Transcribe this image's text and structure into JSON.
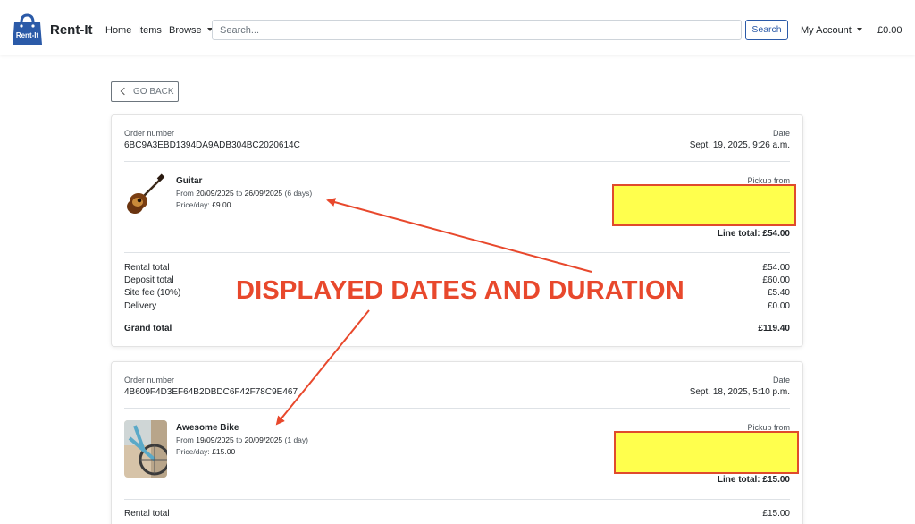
{
  "navbar": {
    "brand": "Rent-It",
    "logo_text": "Rent-It",
    "links": [
      "Home",
      "Items"
    ],
    "browse_label": "Browse",
    "search_placeholder": "Search...",
    "search_button": "Search",
    "account_label": "My Account",
    "cart_total": "£0.00"
  },
  "go_back_label": "GO BACK",
  "orders": [
    {
      "order_number_label": "Order number",
      "order_number": "6BC9A3EBD1394DA9ADB304BC2020614C",
      "date_label": "Date",
      "date": "Sept. 19, 2025, 9:26 a.m.",
      "item": {
        "name": "Guitar",
        "from_label": "From",
        "from_date": "20/09/2025",
        "to_label": "to",
        "to_date": "26/09/2025",
        "duration": "(6 days)",
        "price_label": "Price/day:",
        "price": "£9.00",
        "pickup_label": "Pickup from",
        "line_total": "Line total: £54.00",
        "image_icon": "guitar-image"
      },
      "summary": [
        {
          "label": "Rental total",
          "value": "£54.00"
        },
        {
          "label": "Deposit total",
          "value": "£60.00"
        },
        {
          "label": "Site fee (10%)",
          "value": "£5.40"
        },
        {
          "label": "Delivery",
          "value": "£0.00"
        }
      ],
      "grand_total_label": "Grand total",
      "grand_total": "£119.40"
    },
    {
      "order_number_label": "Order number",
      "order_number": "4B609F4D3EF64B2DBDC6F42F78C9E467",
      "date_label": "Date",
      "date": "Sept. 18, 2025, 5:10 p.m.",
      "item": {
        "name": "Awesome Bike",
        "from_label": "From",
        "from_date": "19/09/2025",
        "to_label": "to",
        "to_date": "20/09/2025",
        "duration": "(1 day)",
        "price_label": "Price/day:",
        "price": "£15.00",
        "pickup_label": "Pickup from",
        "line_total": "Line total: £15.00",
        "image_icon": "bike-image"
      },
      "summary": [
        {
          "label": "Rental total",
          "value": "£15.00"
        }
      ]
    }
  ],
  "annotation": {
    "text": "DISPLAYED DATES AND DURATION",
    "color": "#e8482c",
    "highlight_color": "#ffff4d"
  }
}
